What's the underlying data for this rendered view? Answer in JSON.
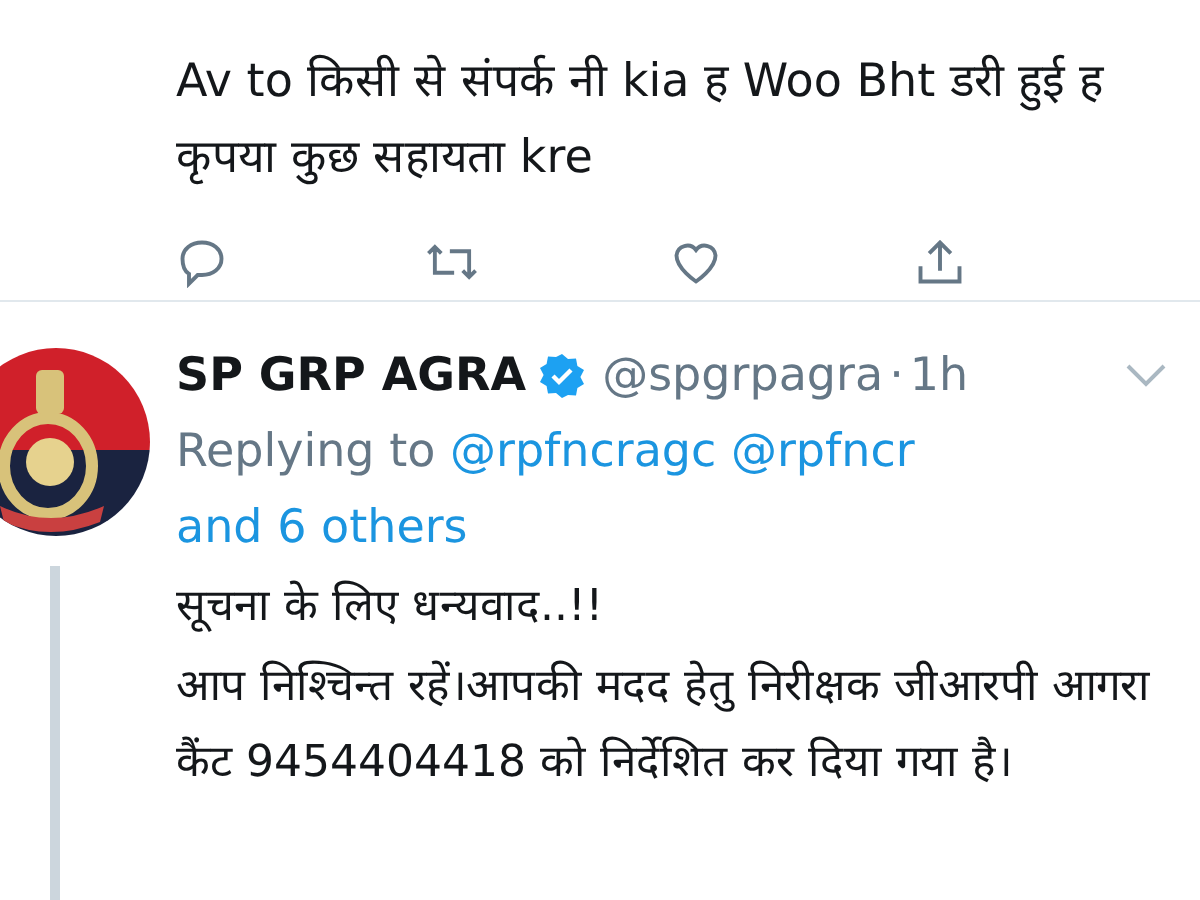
{
  "first_tweet": {
    "text": "Av to किसी से संपर्क नी kia ह Woo Bht डरी हुई ह कृपया कुछ सहायता kre",
    "actions": [
      {
        "kind": "reply"
      },
      {
        "kind": "retweet"
      },
      {
        "kind": "like"
      },
      {
        "kind": "share"
      }
    ]
  },
  "reply_tweet": {
    "name": "SP GRP AGRA",
    "verified": true,
    "handle": "@spgrpagra",
    "separator": "·",
    "time": "1h",
    "replying_label": "Replying to",
    "replying_to": [
      "@rpfncragc",
      "@rpfncr",
      "and 6 others"
    ],
    "paragraphs": [
      "सूचना के लिए धन्यवाद..!!",
      "आप निश्चिन्त रहें।आपकी मदद हेतु निरीक्षक जीआरपी आगरा कैंट 9454404418 को निर्देशित कर दिया गया है।"
    ]
  }
}
